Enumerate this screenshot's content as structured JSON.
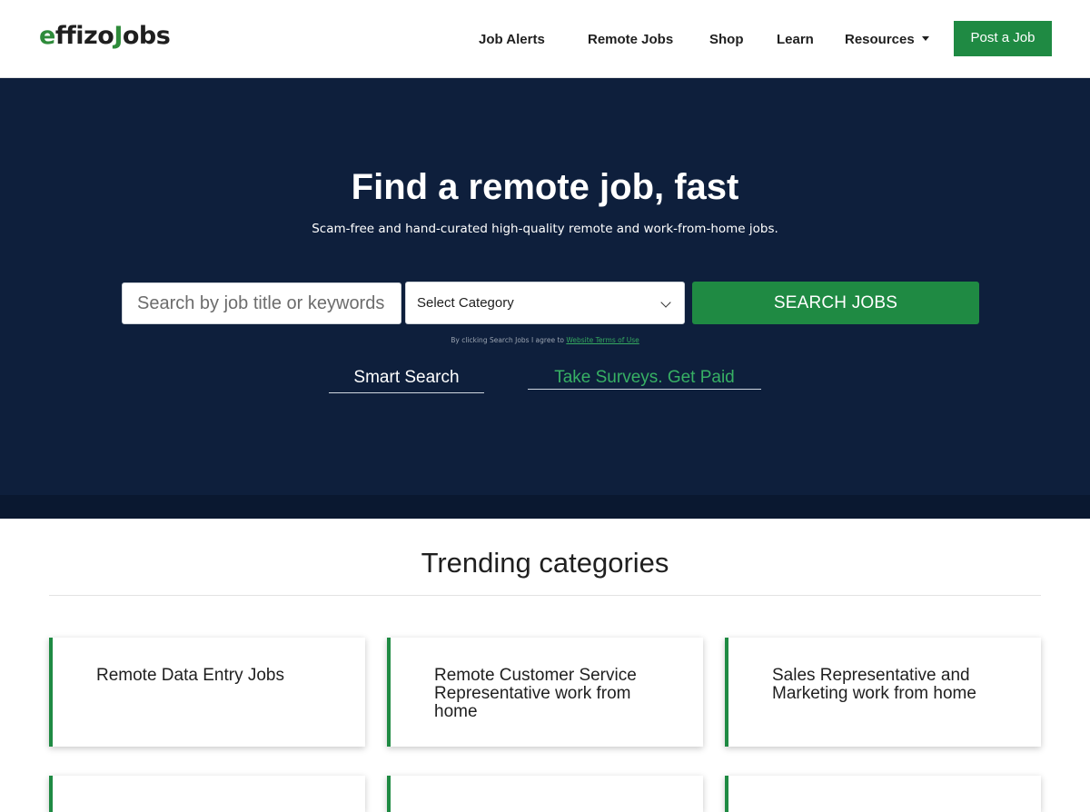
{
  "brand": {
    "logo_first": "e",
    "logo_mid": "ffizo",
    "logo_j": "J",
    "logo_last": "obs"
  },
  "nav": {
    "items": [
      {
        "label": "Job Alerts"
      },
      {
        "label": "Remote Jobs"
      },
      {
        "label": "Shop"
      },
      {
        "label": "Learn"
      },
      {
        "label": "Resources"
      }
    ],
    "post_label": "Post a Job"
  },
  "hero": {
    "title": "Find a remote job, fast",
    "subtitle": "Scam-free and hand-curated high-quality remote and work-from-home jobs.",
    "search_placeholder": "Search by job title or keywords",
    "category_selected": "Select Category",
    "search_button": "SEARCH JOBS",
    "terms_text": "By clicking Search Jobs I agree to ",
    "terms_link": "Website Terms of Use",
    "tab_smart": "Smart Search",
    "tab_surveys": "Take Surveys. Get Paid"
  },
  "trending": {
    "title": "Trending categories",
    "cards": [
      {
        "label": "Remote Data Entry Jobs"
      },
      {
        "label": "Remote Customer Service Representative work from home"
      },
      {
        "label": "Sales Representative and Marketing work from home"
      },
      {
        "label": ""
      },
      {
        "label": ""
      },
      {
        "label": ""
      }
    ]
  },
  "colors": {
    "accent": "#1f8a43",
    "hero_bg": "#0e1f3c",
    "survey_link": "#37b064"
  }
}
